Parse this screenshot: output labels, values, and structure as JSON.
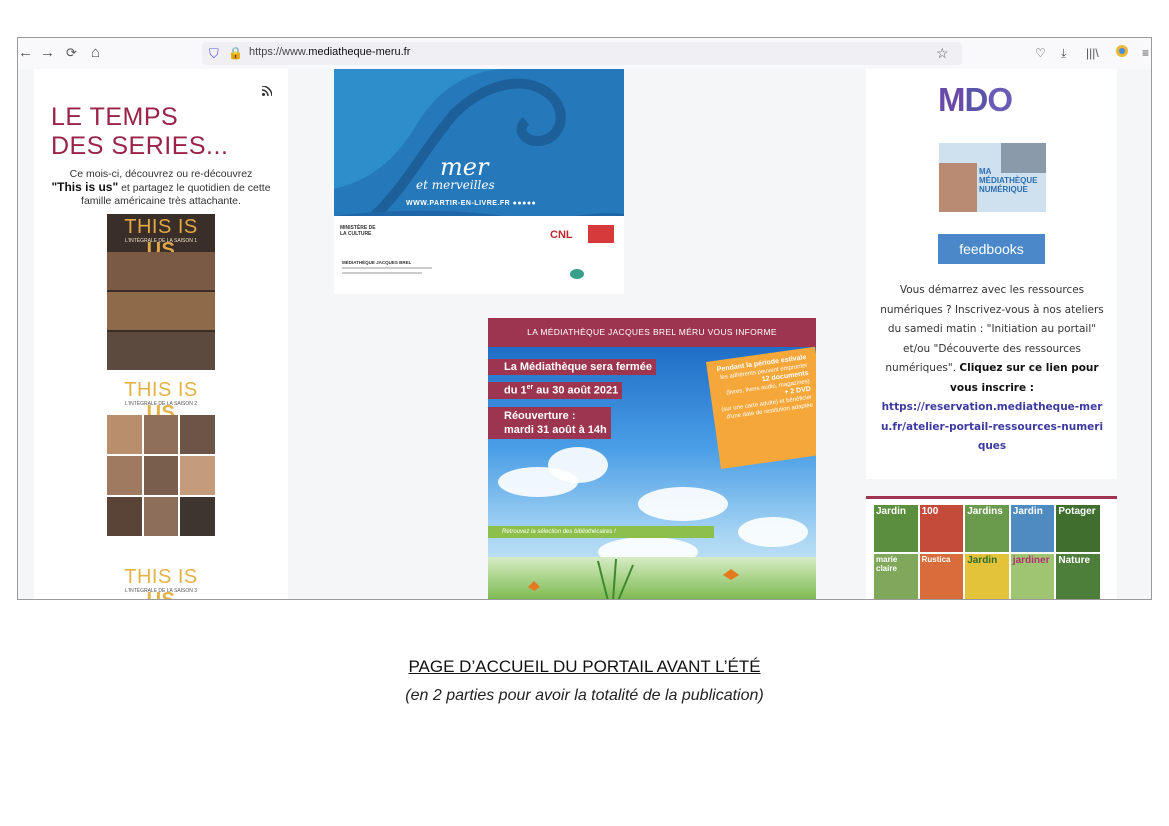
{
  "browser": {
    "url_prefix": "https://www.",
    "url_domain": "mediatheque-meru.fr",
    "nav": {
      "back": "←",
      "forward": "→",
      "reload": "C",
      "home": "⌂"
    }
  },
  "left": {
    "title": "LE TEMPS DES SERIES...",
    "intro_line1": "Ce mois-ci, découvrez ou re-découvrez",
    "intro_show": "\"This is us\"",
    "intro_line2": "et partagez le quotidien de cette famille américaine très attachante.",
    "dvd_title_a": "THIS IS",
    "dvd_title_b": "US",
    "dvd1_sub": "L'INTÉGRALE DE LA SAISON 1",
    "dvd2_sub": "L'INTÉGRALE DE LA SAISON 2",
    "dvd3_sub": "L'INTÉGRALE DE LA SAISON 3"
  },
  "mer": {
    "script": "mer",
    "script2": "et merveilles",
    "url": "WWW.PARTIR-EN-LIVRE.FR",
    "ministere": "MINISTÈRE DE LA CULTURE",
    "cnl": "CNL",
    "venue": "MÉDIATHÈQUE JACQUES BREL"
  },
  "brel": {
    "header": "LA MÉDIATHÈQUE JACQUES BREL MÉRU VOUS INFORME",
    "closed": "La Médiathèque sera fermée",
    "dates": "du 1er au 30 août 2021",
    "reopen1": "Réouverture :",
    "reopen2": "mardi 31 août à 14h",
    "orange_title": "Pendant la période estivale",
    "orange_text1": "les adhérents peuvent emprunter",
    "orange_docs": "12 documents",
    "orange_text2": "(livres, livres audio, magazines)",
    "orange_dvd": "+ 2 DVD",
    "orange_text3": "(sur une carte adulte) et bénéficier d'une date de restitution adaptée",
    "green": "Retrouvez la sélection des bibliothécaires !"
  },
  "right": {
    "mdo": {
      "m": "M",
      "d": "D",
      "o": "O"
    },
    "media_num": "MA MÉDIATHÈQUE NUMÉRIQUE",
    "feedbooks": "feedbooks",
    "desc_plain": "Vous démarrez avec les ressources numériques ? Inscrivez-vous à nos ateliers du samedi matin : \"Initiation au portail\" et/ou \"Découverte des ressources numériques\".",
    "desc_bold": "Cliquez sur ce lien pour vous inscrire :",
    "desc_link": "https://reservation.mediatheque-meru.fr/atelier-portail-ressources-numeriques",
    "magazines": [
      "Jardin",
      "100",
      "Jardins",
      "Jardin",
      "Potager",
      "marie claire",
      "Rustica",
      "Jardin",
      "jardiner",
      "Nature"
    ]
  },
  "caption": {
    "title": "PAGE D’ACCUEIL DU PORTAIL AVANT L’ÉTÉ",
    "subtitle": "(en 2 parties pour avoir la totalité de la publication)"
  },
  "colors": {
    "accent": "#9b2347",
    "link": "#3d3aa0",
    "feedbooks": "#4a88c9"
  }
}
